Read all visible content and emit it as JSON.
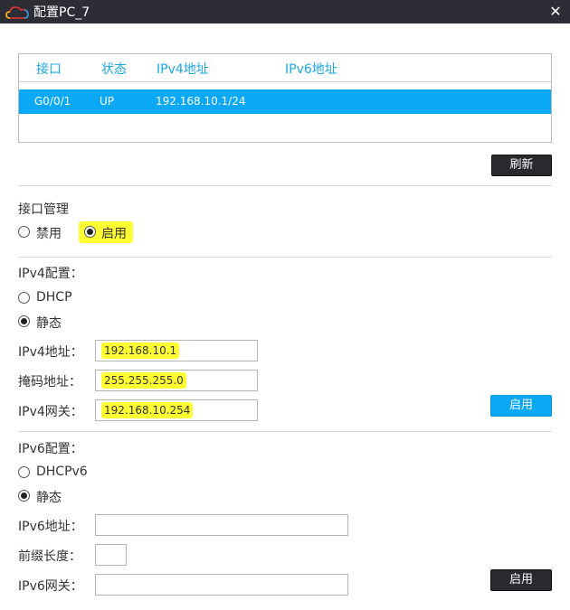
{
  "window": {
    "title": "配置PC_7",
    "close_glyph": "✕"
  },
  "interface_table": {
    "headers": [
      "接口",
      "状态",
      "IPv4地址",
      "IPv6地址"
    ],
    "rows": [
      [
        "G0/0/1",
        "UP",
        "192.168.10.1/24",
        ""
      ]
    ],
    "refresh_label": "刷新"
  },
  "interface_mgmt": {
    "title": "接口管理",
    "options": [
      "禁用",
      "启用"
    ],
    "selected": "启用"
  },
  "ipv4": {
    "title": "IPv4配置：",
    "modes": [
      "DHCP",
      "静态"
    ],
    "selected": "静态",
    "address_label": "IPv4地址：",
    "address_value": "192.168.10.1",
    "mask_label": "掩码地址：",
    "mask_value": "255.255.255.0",
    "gateway_label": "IPv4网关：",
    "gateway_value": "192.168.10.254",
    "apply_label": "启用"
  },
  "ipv6": {
    "title": "IPv6配置：",
    "modes": [
      "DHCPv6",
      "静态"
    ],
    "selected": "静态",
    "address_label": "IPv6地址：",
    "address_value": "",
    "prefix_label": "前缀长度：",
    "prefix_value": "",
    "gateway_label": "IPv6网关：",
    "gateway_value": "",
    "apply_label": "启用"
  },
  "colors": {
    "titlebar": "#2d2d36",
    "accent": "#0aa8f5",
    "highlight": "#ffff33",
    "dark_button": "#2a2a2e"
  },
  "icons": {
    "logo": "cloud-logo-icon",
    "close": "close-icon"
  }
}
